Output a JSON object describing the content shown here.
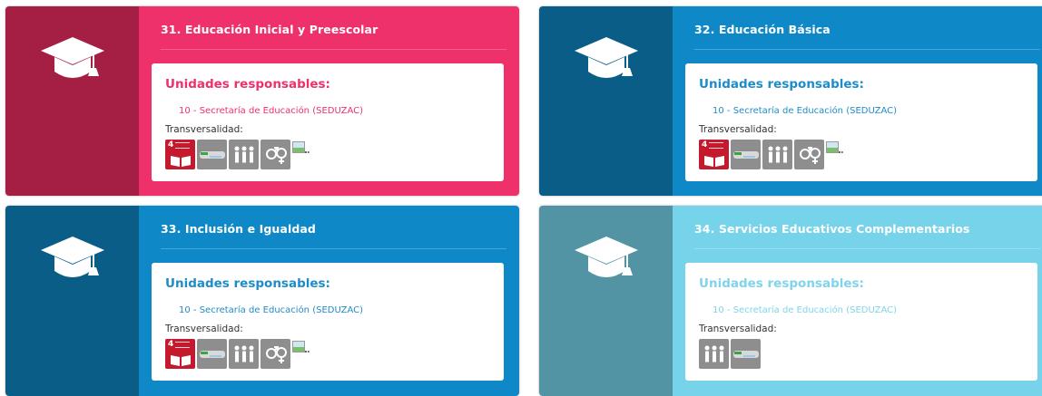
{
  "colors": {
    "pink_side": "#a51f45",
    "pink_main": "#ee306b",
    "blue_side": "#0a5d86",
    "blue_main": "#0e88c7",
    "teal_side": "#5394a4",
    "teal_main": "#76d3ea",
    "ods_red": "#c5192d",
    "icon_gray": "#8e8e8e"
  },
  "cards": [
    {
      "title": "31. Educación Inicial y Preescolar",
      "units_heading": "Unidades responsables:",
      "unit": "10 - Secretaría de Educación (SEDUZAC)",
      "transversal_label": "Transversalidad:",
      "ods_number": "4"
    },
    {
      "title": "32. Educación Básica",
      "units_heading": "Unidades responsables:",
      "unit": "10 - Secretaría de Educación (SEDUZAC)",
      "transversal_label": "Transversalidad:",
      "ods_number": "4"
    },
    {
      "title": "33. Inclusión e Igualdad",
      "units_heading": "Unidades responsables:",
      "unit": "10 - Secretaría de Educación (SEDUZAC)",
      "transversal_label": "Transversalidad:",
      "ods_number": "4"
    },
    {
      "title": "34. Servicios Educativos Complementarios",
      "units_heading": "Unidades responsables:",
      "unit": "10 - Secretaría de Educación (SEDUZAC)",
      "transversal_label": "Transversalidad:"
    }
  ]
}
